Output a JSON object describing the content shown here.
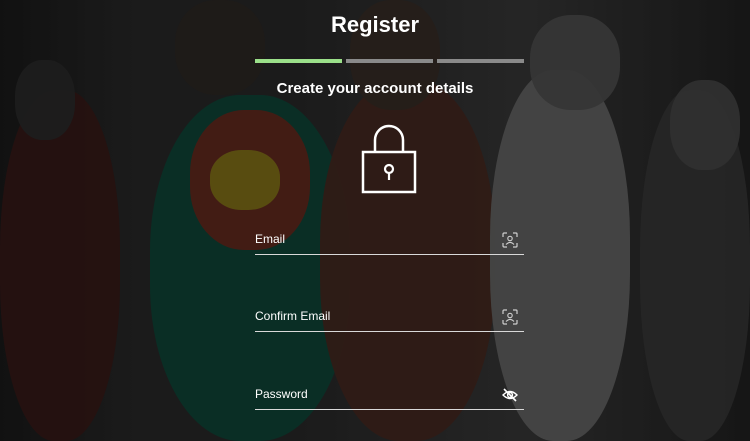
{
  "page": {
    "title": "Register",
    "subtitle": "Create your account details"
  },
  "progress": {
    "current_step": 1,
    "total_steps": 3,
    "colors": {
      "active": "#9be08a",
      "inactive": "#8a8a8a"
    }
  },
  "icons": {
    "lock": "lock-icon",
    "email_autofill": "face-scan-icon",
    "confirm_autofill": "face-scan-icon",
    "password_toggle": "eye-slash-icon"
  },
  "form": {
    "email": {
      "label": "Email",
      "value": ""
    },
    "confirm_email": {
      "label": "Confirm Email",
      "value": ""
    },
    "password": {
      "label": "Password",
      "value": ""
    }
  }
}
